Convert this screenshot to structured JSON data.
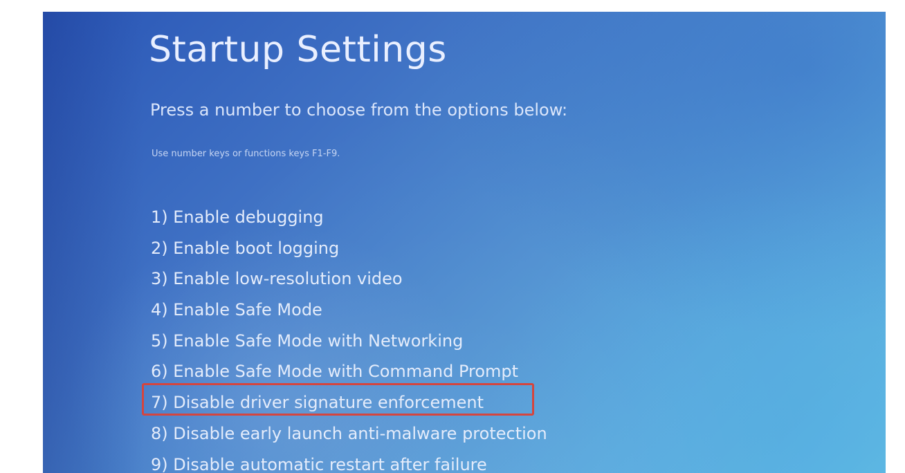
{
  "title": "Startup Settings",
  "prompt": "Press a number to choose from the options below:",
  "hint": "Use number keys or functions keys F1-F9.",
  "options": [
    {
      "label": "1) Enable debugging"
    },
    {
      "label": "2) Enable boot logging"
    },
    {
      "label": "3) Enable low-resolution video"
    },
    {
      "label": "4) Enable Safe Mode"
    },
    {
      "label": "5) Enable Safe Mode with Networking"
    },
    {
      "label": "6) Enable Safe Mode with Command Prompt"
    },
    {
      "label": "7) Disable driver signature enforcement",
      "highlighted": true
    },
    {
      "label": "8) Disable early launch anti-malware protection"
    },
    {
      "label": "9) Disable automatic restart after failure"
    }
  ],
  "colors": {
    "highlight_border": "#d5453e",
    "background_start": "#2a56b6",
    "background_end": "#62bde4"
  }
}
